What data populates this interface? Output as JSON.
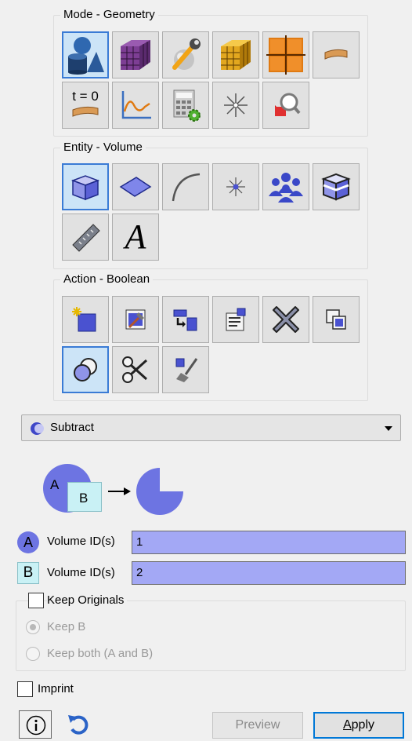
{
  "mode": {
    "title": "Mode - Geometry",
    "time_label": "t = 0"
  },
  "entity": {
    "title": "Entity - Volume"
  },
  "action": {
    "title": "Action - Boolean"
  },
  "dropdown": {
    "value": "Subtract"
  },
  "diagram": {
    "a": "A",
    "b": "B"
  },
  "volume_a": {
    "badge": "A",
    "label": "Volume ID(s)",
    "value": "1"
  },
  "volume_b": {
    "badge": "B",
    "label": "Volume ID(s)",
    "value": "2"
  },
  "keep_originals": {
    "label": "Keep Originals",
    "checked": false
  },
  "keep_b": {
    "label": "Keep B"
  },
  "keep_both": {
    "label": "Keep both (A and B)"
  },
  "imprint": {
    "label": "Imprint",
    "checked": false
  },
  "buttons": {
    "preview": "Preview",
    "apply_first": "A",
    "apply_rest": "pply"
  },
  "colors": {
    "selected": "#cce4f7",
    "field": "#a3a8f5",
    "accent": "#3a7bd5"
  }
}
